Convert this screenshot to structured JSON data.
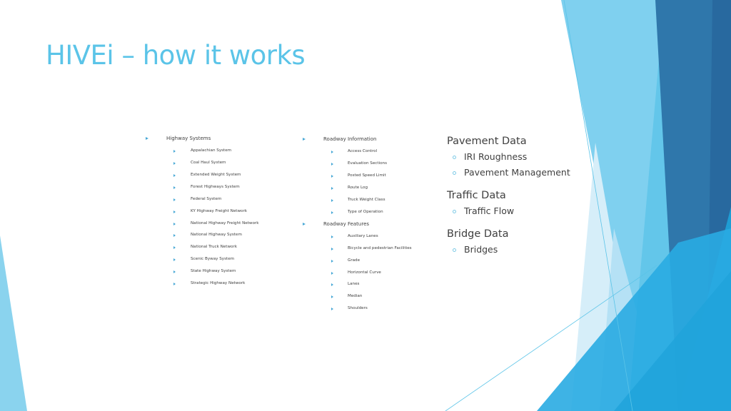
{
  "slide": {
    "title": "HIVEi – how it works"
  },
  "columns": [
    {
      "groups": [
        {
          "label": "Highway Systems",
          "items": [
            "Appalachian System",
            "Coal Haul System",
            "Extended Weight System",
            "Forest Highways System",
            "Federal System",
            "KY Highway Freight Network",
            "National Highway Freight Network",
            "National Highway System",
            "National Truck Network",
            "Scenic Byway System",
            "State Highway System",
            "Strategic Highway Network"
          ]
        }
      ]
    },
    {
      "groups": [
        {
          "label": "Roadway Information",
          "items": [
            "Access Control",
            "Evaluation Sections",
            "Posted Speed Limit",
            "Route Log",
            "Truck Weight Class",
            "Type of Operation"
          ]
        },
        {
          "label": "Roadway Features",
          "items": [
            "Auxiliary Lanes",
            "Bicycle and pedestrian Facilities",
            "Grade",
            "Horizontal Curve",
            "Lanes",
            "Median",
            "Shoulders"
          ]
        }
      ]
    }
  ],
  "data_sections": [
    {
      "heading": "Pavement Data",
      "items": [
        "IRI Roughness",
        "Pavement Management"
      ]
    },
    {
      "heading": "Traffic Data",
      "items": [
        "Traffic Flow"
      ]
    },
    {
      "heading": "Bridge Data",
      "items": [
        "Bridges"
      ]
    }
  ],
  "colors": {
    "title": "#5bc4e8",
    "bullet": "#4aa9d6",
    "text": "#404040",
    "accent_light": "#7dd0ee",
    "accent_mid": "#29abe2",
    "accent_dark": "#2b6ca3"
  }
}
